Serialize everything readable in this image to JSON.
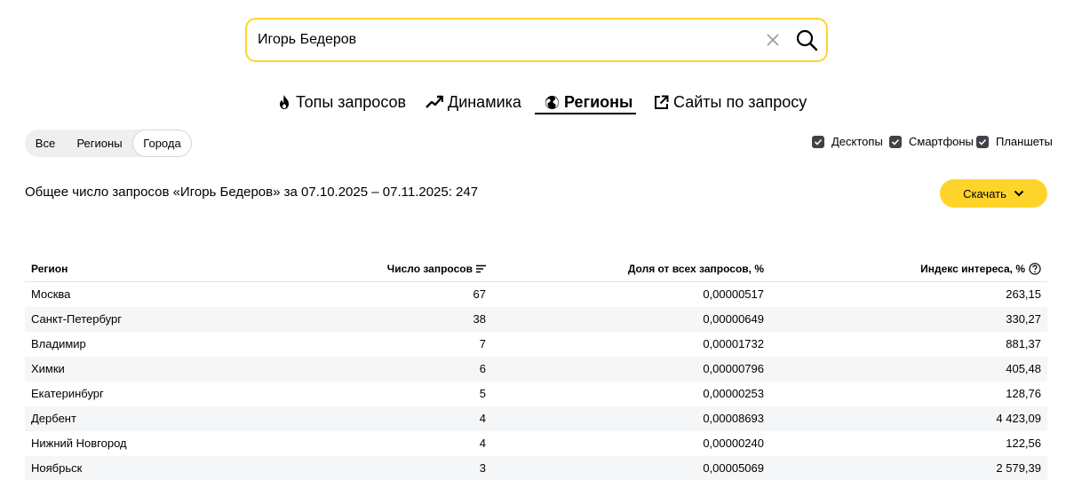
{
  "search": {
    "value": "Игорь Бедеров"
  },
  "tabs": [
    {
      "label": "Топы запросов",
      "icon": "fire-icon"
    },
    {
      "label": "Динамика",
      "icon": "trend-icon"
    },
    {
      "label": "Регионы",
      "icon": "globe-icon",
      "active": true
    },
    {
      "label": "Сайты по запросу",
      "icon": "external-link-icon"
    }
  ],
  "region_filter": {
    "options": [
      "Все",
      "Регионы",
      "Города"
    ],
    "selected": "Города"
  },
  "devices": [
    {
      "label": "Десктопы",
      "checked": true
    },
    {
      "label": "Смартфоны",
      "checked": true
    },
    {
      "label": "Планшеты",
      "checked": true
    }
  ],
  "summary": "Общее число запросов «Игорь Бедеров» за 07.10.2025 – 07.11.2025: 247",
  "download_label": "Скачать",
  "table": {
    "headers": {
      "region": "Регион",
      "count": "Число запросов",
      "share": "Доля от всех запросов, %",
      "index": "Индекс интереса, %"
    },
    "rows": [
      {
        "region": "Москва",
        "count": "67",
        "share": "0,00000517",
        "index": "263,15"
      },
      {
        "region": "Санкт-Петербург",
        "count": "38",
        "share": "0,00000649",
        "index": "330,27"
      },
      {
        "region": "Владимир",
        "count": "7",
        "share": "0,00001732",
        "index": "881,37"
      },
      {
        "region": "Химки",
        "count": "6",
        "share": "0,00000796",
        "index": "405,48"
      },
      {
        "region": "Екатеринбург",
        "count": "5",
        "share": "0,00000253",
        "index": "128,76"
      },
      {
        "region": "Дербент",
        "count": "4",
        "share": "0,00008693",
        "index": "4 423,09"
      },
      {
        "region": "Нижний Новгород",
        "count": "4",
        "share": "0,00000240",
        "index": "122,56"
      },
      {
        "region": "Ноябрьск",
        "count": "3",
        "share": "0,00005069",
        "index": "2 579,39"
      }
    ]
  },
  "colors": {
    "accent": "#fed42b",
    "row_stripe": "#f5f6f7",
    "checkbox": "#3f4249"
  }
}
